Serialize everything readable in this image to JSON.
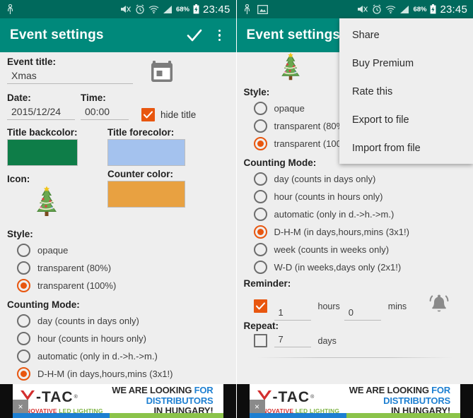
{
  "status_bar": {
    "time": "23:45",
    "battery_percent": "68%",
    "icons_left_panel": [
      "usb-icon"
    ],
    "icons_right_panel": [
      "usb-icon",
      "image-icon"
    ],
    "icons_right": [
      "mute-icon",
      "alarm-icon",
      "wifi-icon",
      "signal-icon",
      "battery-charging-icon"
    ]
  },
  "toolbar": {
    "title": "Event settings",
    "confirm_icon": "check-icon",
    "overflow_icon": "kebab-menu-icon"
  },
  "form": {
    "event_title_label": "Event title:",
    "event_title_value": "Xmas",
    "calendar_icon": "calendar-icon",
    "date_label": "Date:",
    "date_value": "2015/12/24",
    "time_label": "Time:",
    "time_value": "00:00",
    "hide_title_label": "hide title",
    "hide_title_checked": true,
    "title_backcolor_label": "Title backcolor:",
    "title_backcolor": "#0e7d48",
    "title_forecolor_label": "Title forecolor:",
    "title_forecolor": "#a4c2ee",
    "counter_color_label": "Counter color:",
    "counter_color": "#e8a141",
    "icon_label": "Icon:",
    "icon_value": "christmas-tree-icon",
    "style_label": "Style:",
    "style_options": [
      {
        "label": "opaque",
        "selected": false
      },
      {
        "label": "transparent (80%)",
        "selected": false
      },
      {
        "label": "transparent (100%)",
        "selected": true
      }
    ],
    "counting_mode_label": "Counting Mode:",
    "counting_mode_options": [
      {
        "label": "day (counts in days only)",
        "selected": false
      },
      {
        "label": "hour (counts in hours only)",
        "selected": false
      },
      {
        "label": "automatic (only in d.->h.->m.)",
        "selected": false
      },
      {
        "label": "D-H-M (in days,hours,mins (3x1!)",
        "selected": true
      },
      {
        "label": "week (counts in weeks only)",
        "selected": false
      },
      {
        "label": "W-D (in weeks,days only (2x1!)",
        "selected": false
      }
    ],
    "reminder_label": "Reminder:",
    "reminder_checked": true,
    "reminder_hours": "1",
    "reminder_hours_unit": "hours",
    "reminder_mins": "0",
    "reminder_mins_unit": "mins",
    "reminder_bell_icon": "bell-ringing-icon",
    "repeat_label": "Repeat:",
    "repeat_checked": false,
    "repeat_days": "7",
    "repeat_unit": "days"
  },
  "overflow_menu": {
    "items": [
      "Share",
      "Buy Premium",
      "Rate this",
      "Export to file",
      "Import from file"
    ]
  },
  "ad": {
    "brand": "-TAC",
    "brand_mark": "V",
    "registered": "®",
    "tagline_red": "INNOVATIVE ",
    "tagline_green": "LED LIGHTING",
    "line1_plain": "WE ARE LOOKING ",
    "line1_blue": "FOR DISTRIBUTORS",
    "line2": "IN HUNGARY!",
    "close_label": "×",
    "accent_blue": "#1d7fd1",
    "accent_green": "#8bc34a",
    "accent_red": "#d32f2f"
  },
  "theme": {
    "statusbar_color": "#00695c",
    "toolbar_color": "#00897b",
    "accent_orange": "#e8560f",
    "page_background": "#eeeeee"
  }
}
